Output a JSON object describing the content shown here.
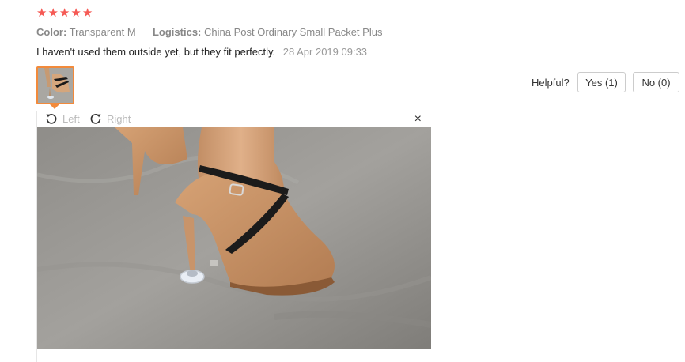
{
  "review": {
    "rating": 5,
    "stars": [
      "★",
      "★",
      "★",
      "★",
      "★"
    ],
    "color_label": "Color:",
    "color_value": "Transparent M",
    "logistics_label": "Logistics:",
    "logistics_value": "China Post Ordinary Small Packet Plus",
    "comment": "I haven't used them outside yet, but they fit perfectly.",
    "date": "28 Apr 2019 09:33"
  },
  "viewer": {
    "rotate_left_label": "Left",
    "rotate_right_label": "Right",
    "close_icon": "×"
  },
  "helpful": {
    "label": "Helpful?",
    "yes_label": "Yes (1)",
    "no_label": "No (0)"
  },
  "colors": {
    "star": "#f55a55",
    "thumb_border": "#f28a3b"
  }
}
